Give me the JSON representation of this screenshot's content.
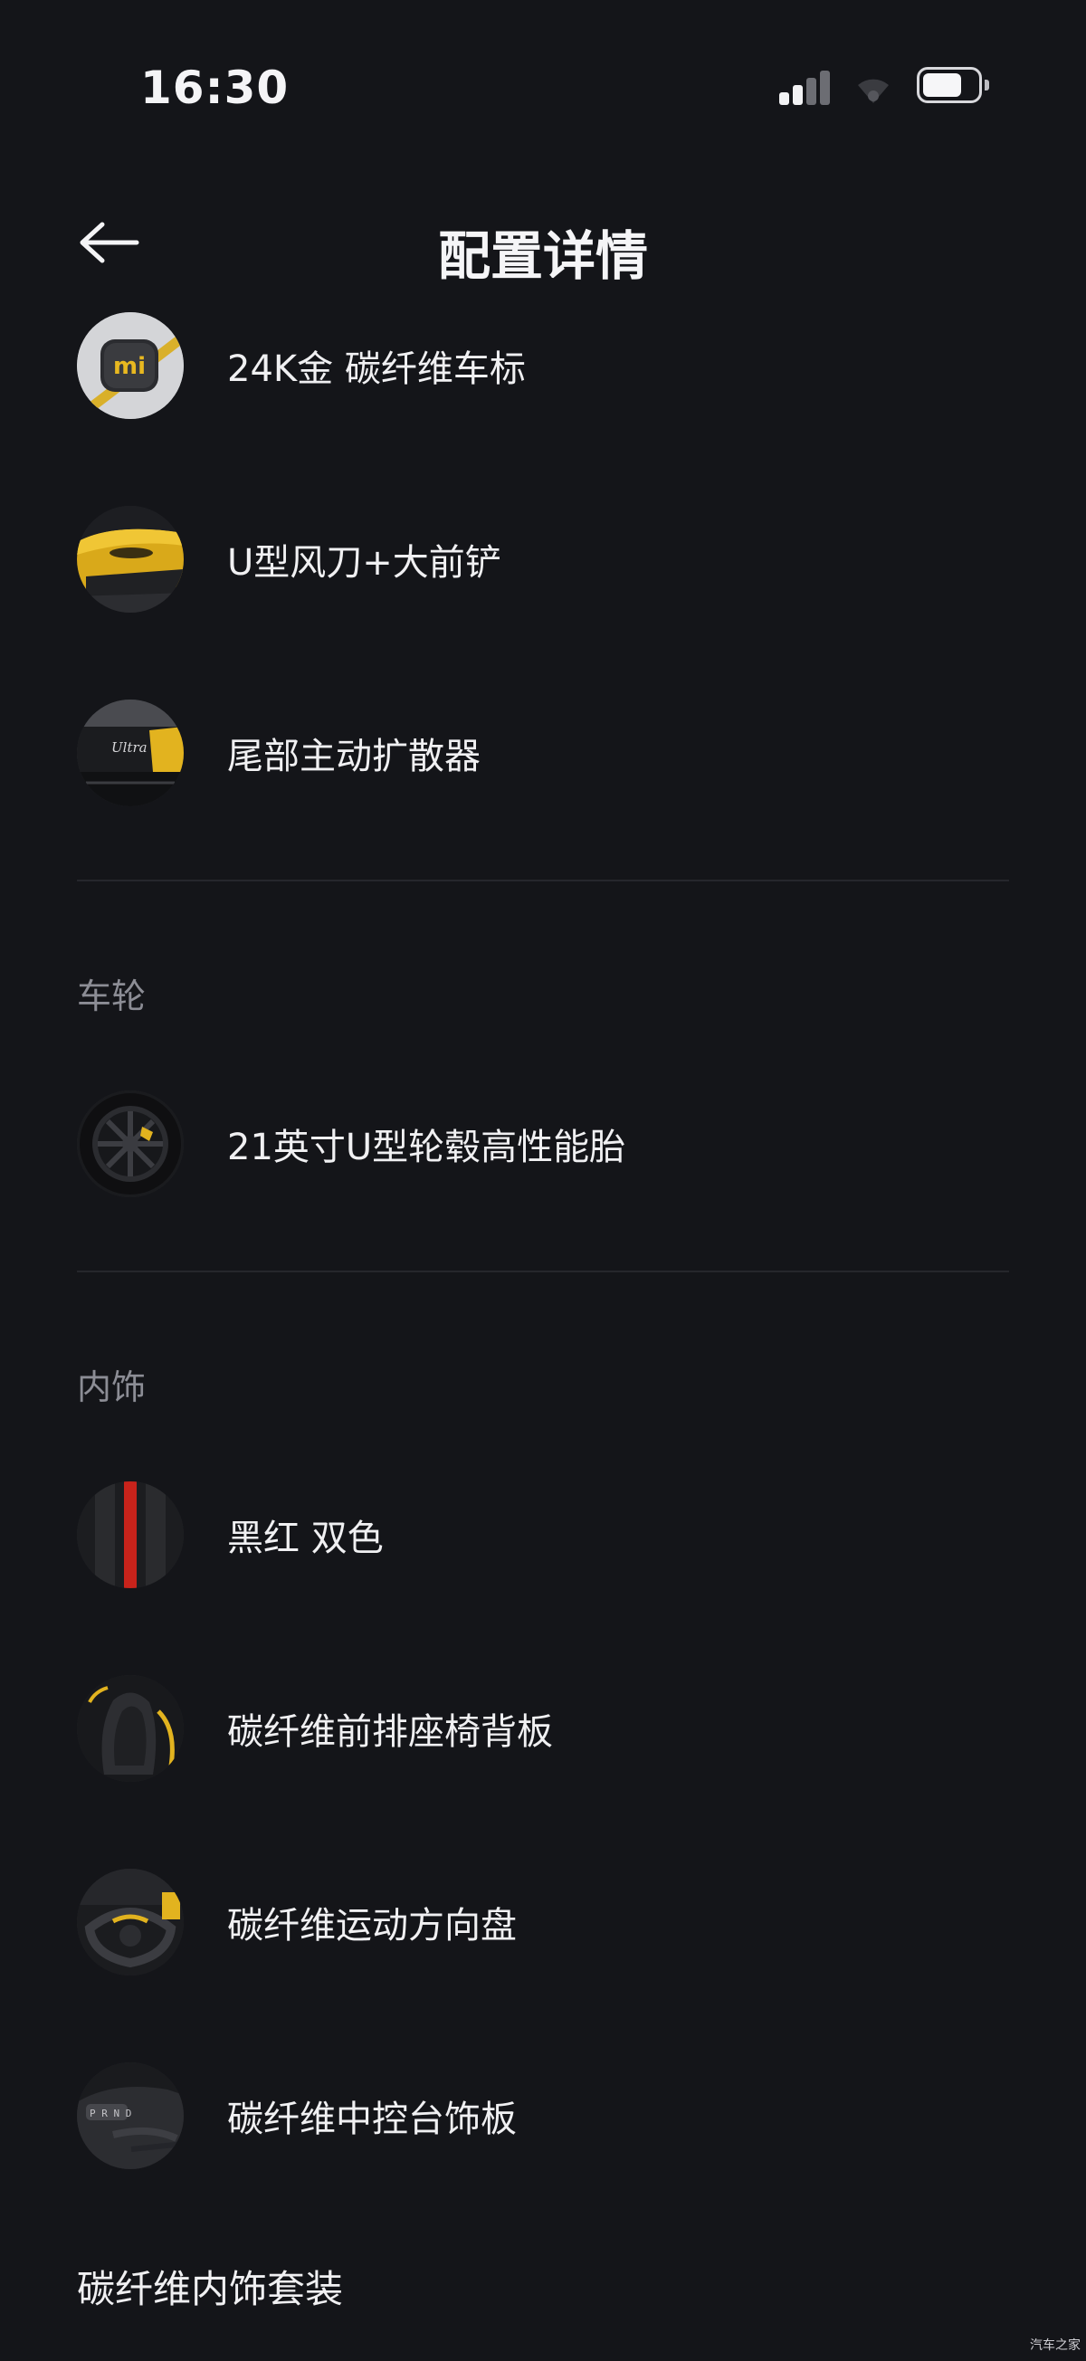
{
  "status_bar": {
    "time": "16:30",
    "signal_icon": "cellular-signal-icon",
    "wifi_icon": "wifi-icon",
    "battery_icon": "battery-icon"
  },
  "nav": {
    "back_icon": "back-arrow-icon",
    "title": "配置详情"
  },
  "exterior_items": [
    {
      "label": "24K金 碳纤维车标",
      "thumb": "xiaomi-logo-badge"
    },
    {
      "label": "U型风刀+大前铲",
      "thumb": "yellow-car-front"
    },
    {
      "label": "尾部主动扩散器",
      "thumb": "rear-diffuser"
    }
  ],
  "wheels": {
    "section_title": "车轮",
    "items": [
      {
        "label": "21英寸U型轮毂高性能胎",
        "thumb": "wheel"
      }
    ]
  },
  "interior": {
    "section_title": "内饰",
    "items": [
      {
        "label": "黑红 双色",
        "thumb": "black-red-swatch"
      },
      {
        "label": "碳纤维前排座椅背板",
        "thumb": "seat-back"
      },
      {
        "label": "碳纤维运动方向盘",
        "thumb": "steering-wheel"
      },
      {
        "label": "碳纤维中控台饰板",
        "thumb": "center-console"
      }
    ]
  },
  "footer": {
    "title": "碳纤维内饰套装"
  },
  "watermark": "汽车之家",
  "colors": {
    "background": "#141519",
    "text": "#f0f0f2",
    "section_title": "#8c8d95",
    "divider": "#26272c",
    "accent_yellow": "#e8b820",
    "accent_red": "#c8231b"
  }
}
